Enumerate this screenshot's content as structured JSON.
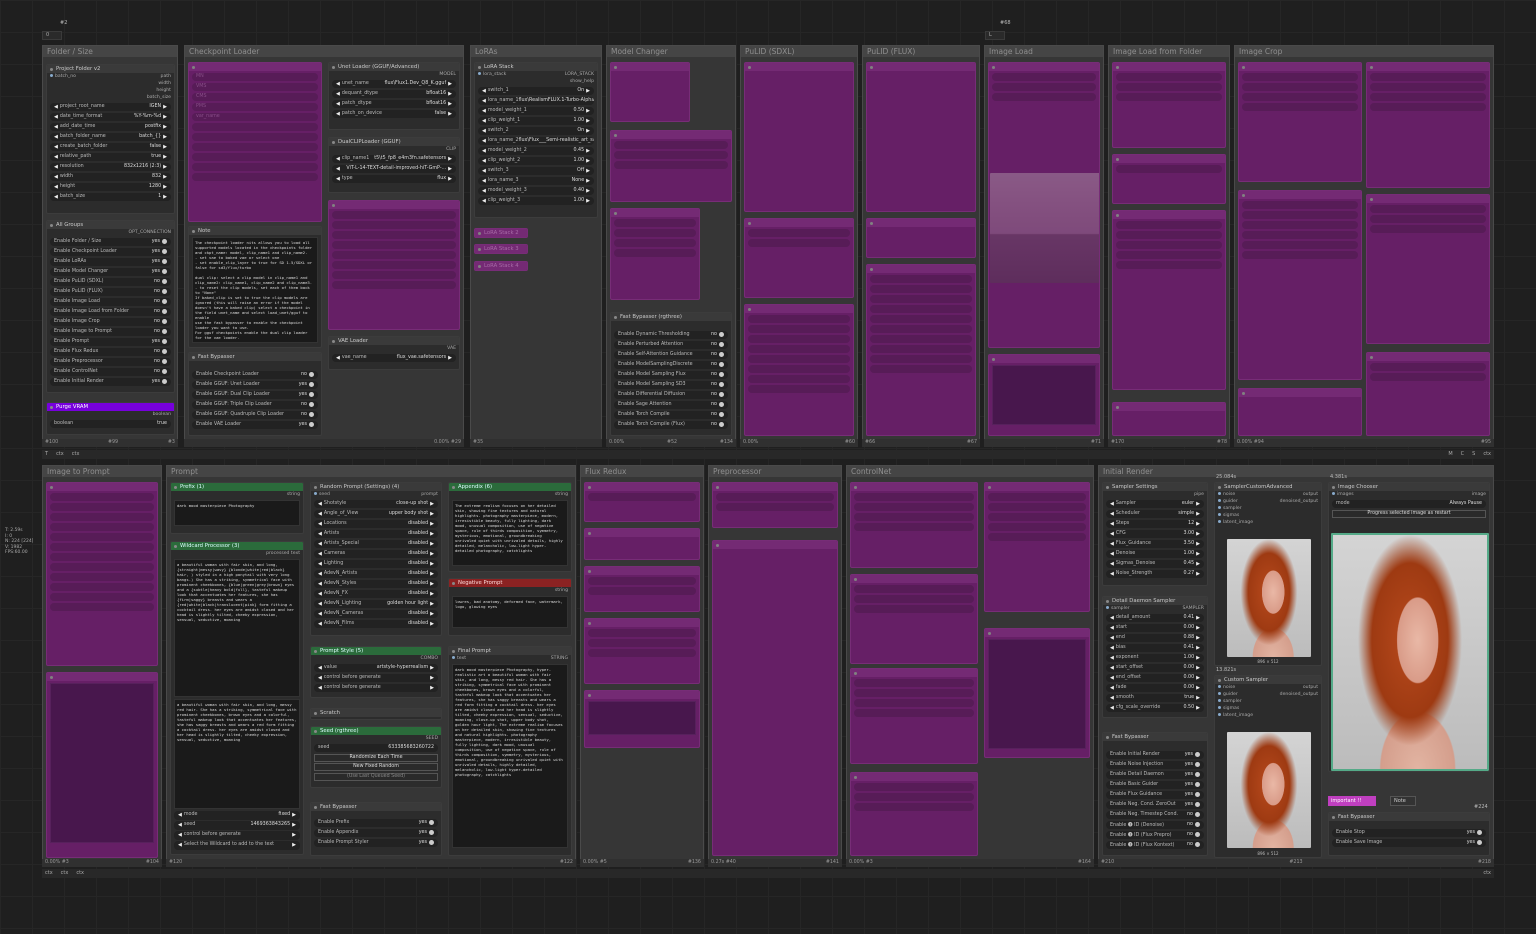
{
  "top_tags": {
    "t1": "#2",
    "t2": "#68"
  },
  "top_bars": {
    "b1": "0",
    "b2": "L"
  },
  "side_info": {
    "l1": "T: 2.59s",
    "l2": "I: 0",
    "l3": "N: 224 [224]",
    "l4": "V: 1982",
    "l5": "FPS:60.00"
  },
  "groups": {
    "folder_size": "Folder / Size",
    "checkpoint_loader": "Checkpoint Loader",
    "loras": "LoRAs",
    "model_changer": "Model Changer",
    "pulid_sdxl": "PuLID (SDXL)",
    "pulid_flux": "PuLID (FLUX)",
    "image_load": "Image Load",
    "image_load_folder": "Image Load from Folder",
    "image_crop": "Image Crop",
    "image_to_prompt": "Image to Prompt",
    "prompt": "Prompt",
    "flux_redux": "Flux Redux",
    "preprocessor": "Preprocessor",
    "controlnet": "ControlNet",
    "initial_render": "Initial Render"
  },
  "project_folder": {
    "title": "Project Folder v2",
    "id": "#5",
    "out1": "batch_no",
    "out_path": "path",
    "out_width": "width",
    "out_height": "height",
    "out_batch": "batch_size",
    "rows": [
      {
        "k": "project_root_name",
        "v": "IGEN"
      },
      {
        "k": "date_time_format",
        "v": "%Y-%m-%d"
      },
      {
        "k": "add_date_time",
        "v": "postfix"
      },
      {
        "k": "batch_folder_name",
        "v": "batch_{}"
      },
      {
        "k": "create_batch_folder",
        "v": "false"
      },
      {
        "k": "relative_path",
        "v": "true"
      },
      {
        "k": "resolution",
        "v": "832x1216 (2:3)"
      },
      {
        "k": "width",
        "v": "832"
      },
      {
        "k": "height",
        "v": "1280"
      },
      {
        "k": "batch_size",
        "v": "1"
      }
    ],
    "footer_id": "#1"
  },
  "all_groups": {
    "title": "All Groups",
    "out": "OPT_CONNECTION",
    "rows": [
      {
        "k": "Enable Folder / Size",
        "v": "yes"
      },
      {
        "k": "Enable Checkpoint Loader",
        "v": "yes"
      },
      {
        "k": "Enable LoRAs",
        "v": "yes"
      },
      {
        "k": "Enable Model Changer",
        "v": "yes"
      },
      {
        "k": "Enable PuLID (SDXL)",
        "v": "no"
      },
      {
        "k": "Enable PuLID (FLUX)",
        "v": "no"
      },
      {
        "k": "Enable Image Load",
        "v": "no"
      },
      {
        "k": "Enable Image Load from Folder",
        "v": "no"
      },
      {
        "k": "Enable Image Crop",
        "v": "no"
      },
      {
        "k": "Enable Image to Prompt",
        "v": "no"
      },
      {
        "k": "Enable Prompt",
        "v": "yes"
      },
      {
        "k": "Enable Flux Redux",
        "v": "no"
      },
      {
        "k": "Enable Preprocessor",
        "v": "no"
      },
      {
        "k": "Enable ControlNet",
        "v": "no"
      },
      {
        "k": "Enable Initial Render",
        "v": "yes"
      }
    ]
  },
  "purge_vram": {
    "title": "Purge VRAM",
    "out": "boolean",
    "row_k": "boolean",
    "row_v": "true",
    "id": "#3"
  },
  "folder_foot": {
    "a": "#100",
    "b": "#99"
  },
  "checkpoint_muted": {
    "id": "#17",
    "labels": [
      "MN",
      "VMS",
      "CMS",
      "PMS",
      "var_name"
    ],
    "tags": [
      "#16",
      "#18",
      "#19",
      "#20"
    ]
  },
  "note": {
    "title": "Note",
    "text": "The checkpoint loader nits allows you to load all supported models located in the checkpoints folder and ckpt_name: model, clip_name1 and clip_name2.\n- set vae to baked vae or select one\n- set enable_clip_layer to true for SD 1.5/SDXL or false for sd3/flux/turbo\n\ndual clip: select a clip model in clip_name1 and clip_name2: clip_name1, clip_name2 and clip_name3.\n- to reset the clip models, set each of them back to \"None\"\nIf baked_clip is set to true the clip models are ignored (this will raise an error if the model doesn't have a baked clip) select a checkpoint in the field unet_name and select load_unet/gguf to enable\nuse the fast bypasser to enable the checkpoint loader you want to use.\nFor gguf checkpoints enable the dual clip loader for the vae loader.",
    "id": "#27"
  },
  "fast_bypasser_ckpt": {
    "title": "Fast Bypasser",
    "rows": [
      {
        "k": "Enable Checkpoint Loader",
        "v": "no"
      },
      {
        "k": "Enable GGUF: Unet Loader",
        "v": "yes"
      },
      {
        "k": "Enable GGUF: Dual Clip Loader",
        "v": "yes"
      },
      {
        "k": "Enable GGUF: Triple Clip Loader",
        "v": "no"
      },
      {
        "k": "Enable GGUF: Quadruple Clip Loader",
        "v": "no"
      },
      {
        "k": "Enable VAE Loader",
        "v": "yes"
      }
    ]
  },
  "unet_loader": {
    "title": "Unet Loader (GGUF/Advanced)",
    "id": "#26",
    "out": "MODEL",
    "rows": [
      {
        "k": "unet_name",
        "v": "flux\\Flux1.Dev_Q8_K.gguf"
      },
      {
        "k": "dequant_dtype",
        "v": "bfloat16"
      },
      {
        "k": "patch_dtype",
        "v": "bfloat16"
      },
      {
        "k": "patch_on_device",
        "v": "false"
      }
    ],
    "foot_id": "#15"
  },
  "dual_clip": {
    "title": "DualCLIPLoader (GGUF)",
    "out": "CLIP",
    "rows": [
      {
        "k": "clip_name1",
        "v": "t5\\t5_fp8_e4m3fn.safetensors"
      },
      {
        "k": "",
        "v": "ViT-L-14-TEXT-detail-improved-hiT-GmP-..."
      },
      {
        "k": "type",
        "v": "flux"
      }
    ]
  },
  "vae_loader": {
    "title": "VAE Loader",
    "out": "VAE",
    "rows": [
      {
        "k": "vae_name",
        "v": "flux_vae.safetensors"
      }
    ],
    "id": "#28"
  },
  "checkpoint_foot": {
    "a": "0.00%",
    "b": "#29"
  },
  "lora_stack": {
    "title": "LoRA Stack",
    "id": "#37",
    "in1": "lora_stack",
    "out1": "LORA_STACK",
    "out2": "show_help",
    "rows": [
      {
        "k": "switch_1",
        "v": "On"
      },
      {
        "k": "lora_name_1",
        "v": "flux\\RealismFLUX.1-Turbo-Alpha.saf..."
      },
      {
        "k": "model_weight_1",
        "v": "0.50"
      },
      {
        "k": "clip_weight_1",
        "v": "1.00"
      },
      {
        "k": "switch_2",
        "v": "On"
      },
      {
        "k": "lora_name_2",
        "v": "flux\\Flux___Semi-realistic_art_style-00..."
      },
      {
        "k": "model_weight_2",
        "v": "0.45"
      },
      {
        "k": "clip_weight_2",
        "v": "1.00"
      },
      {
        "k": "switch_3",
        "v": "Off"
      },
      {
        "k": "lora_name_3",
        "v": "None"
      },
      {
        "k": "model_weight_3",
        "v": "0.40"
      },
      {
        "k": "clip_weight_3",
        "v": "1.00"
      }
    ],
    "stack2": "LoRA Stack 2",
    "stack2_id": "#31",
    "stack3": "LoRA Stack 3",
    "stack3_id": "#32",
    "stack4": "LoRA Stack 4",
    "foot": "#35"
  },
  "model_changer_bypass": {
    "title": "Fast Bypasser (rgthree)",
    "id": "#51",
    "rows": [
      {
        "k": "Enable Dynamic Thresholding",
        "v": "no"
      },
      {
        "k": "Enable Perturbed Attention",
        "v": "no"
      },
      {
        "k": "Enable Self-Attention Guidance",
        "v": "no"
      },
      {
        "k": "Enable ModelSamplingDiscrete",
        "v": "no"
      },
      {
        "k": "Enable Model Sampling Flux",
        "v": "no"
      },
      {
        "k": "Enable Model Sampling SD3",
        "v": "no"
      },
      {
        "k": "Enable Differential Diffusion",
        "v": "no"
      },
      {
        "k": "Enable Sage Attention",
        "v": "no"
      },
      {
        "k": "Enable Torch Compile",
        "v": "no"
      },
      {
        "k": "Enable Torch Compile (Flux)",
        "v": "no"
      }
    ]
  },
  "top_foot_ids": {
    "mc_a": "0.00%",
    "mc_b": "#36",
    "mc_c": "#52",
    "mc_d": "#134",
    "mc_e": "#139",
    "ps_a": "0.00%",
    "ps_b": "#59",
    "ps_c": "#60",
    "pf_a": "#66",
    "pf_b": "#67",
    "il_a": "#71",
    "if_a": "#170",
    "if_b": "#78",
    "ic_a": "0.00%",
    "ic_b": "#94",
    "ic_c": "#95"
  },
  "bottom_labels": {
    "l1": "T",
    "l2": "M",
    "l3": "C",
    "l4": "S",
    "ctx": "ctx"
  },
  "prefix": {
    "title": "Prefix (1)",
    "id": "#112",
    "out": "string",
    "text": "dark mood masterpiece Photography",
    "foot_id": "#128"
  },
  "wildcard": {
    "title": "Wildcard Processor (3)",
    "out": "processed text",
    "text1": "a beautiful woman with fair skin, and long, {straight|messy|wavy} {blonde|white|red|black} hair, ) styled in a high ponytail with very long bangs.) She has a striking, symmetrical face with prominent cheekbones, {blue|green|grey|brown} eyes and a {subtle|heavy bold|full}, tasteful makeup look that accentuates her features, she has {firm|saggy} breasts and wears a {red|white|black|translucent|pink} form fitting a cocktail dress. her eyes are amidst closed and her head is slightly tilted, cheeky expression, sensual, seductive, moaning",
    "text2": "a beautiful woman with fair skin, and long, messy red hair. She has a striking, symmetrical face with prominent cheekbones, brown eyes and a colorful, tasteful makeup look that accentuates her features, she has saggy breasts and wears a red form fitting a cocktail dress. her eyes are amidst closed and her head is slightly tilted, cheeky expression, sensual, seductive, moaning",
    "rows": [
      {
        "k": "mode",
        "v": "fixed"
      },
      {
        "k": "seed",
        "v": "1469363843265"
      },
      {
        "k": "control before generate",
        "v": ""
      },
      {
        "k": "Select the Wildcard to add to the text",
        "v": ""
      }
    ],
    "foot_id": "#120"
  },
  "random_prompt": {
    "title": "Random Prompt (Settings) (4)",
    "id": "#121",
    "in": "seed",
    "out": "prompt",
    "rows": [
      {
        "k": "Shotstyle",
        "v": "close-up shot"
      },
      {
        "k": "Angle_of_View",
        "v": "upper body shot"
      },
      {
        "k": "Locations",
        "v": "disabled"
      },
      {
        "k": "Artists",
        "v": "disabled"
      },
      {
        "k": "Artists_Special",
        "v": "disabled"
      },
      {
        "k": "Cameras",
        "v": "disabled"
      },
      {
        "k": "Lighting",
        "v": "disabled"
      },
      {
        "k": "AdevN_Artists",
        "v": "disabled"
      },
      {
        "k": "AdevN_Styles",
        "v": "disabled"
      },
      {
        "k": "AdevN_FX",
        "v": "disabled"
      },
      {
        "k": "AdevN_Lighting",
        "v": "golden hour light"
      },
      {
        "k": "AdevN_Cameras",
        "v": "disabled"
      },
      {
        "k": "AdevN_Films",
        "v": "disabled"
      }
    ]
  },
  "prompt_style": {
    "title": "Prompt Style (5)",
    "out": "COMBO",
    "rows": [
      {
        "k": "value",
        "v": "artstyle-hyperrealism"
      },
      {
        "k": "control before generate",
        "v": ""
      },
      {
        "k": "control before generate",
        "v": ""
      }
    ],
    "foot_id": "#118"
  },
  "scratch": {
    "title": "Scratch"
  },
  "seed": {
    "title": "Seed (rgthree)",
    "out": "SEED",
    "rows": [
      {
        "k": "seed",
        "v": "633385683260722"
      }
    ],
    "btn1": "Randomize Each Time",
    "btn2": "New Fixed Random",
    "btn3": "(Use Last Queued Seed)",
    "foot_id": "#119"
  },
  "prompt_bypasser": {
    "title": "Fast Bypasser",
    "rows": [
      {
        "k": "Enable Prefix",
        "v": "yes"
      },
      {
        "k": "Enable Appendix",
        "v": "yes"
      },
      {
        "k": "Enable Prompt Styler",
        "v": "yes"
      }
    ]
  },
  "appendix": {
    "title": "Appendix (6)",
    "id": "#116",
    "out": "string",
    "text": "The extreme realism focuses on her detailed skin, showing fine textures and natural highlights. photography masterpiece, modern, irresistible beauty, fully lighting, dark mood, unusual composition, use of negative space, rule of thirds composition, symmetry, mysterious, emotional, groundbreaking unrivaled quiet with unrivaled details, highly detailed, melancholic, low-light hyper-detailed photography, catchlights",
    "foot_id": "#117"
  },
  "negative": {
    "title": "Negative Prompt",
    "out": "string",
    "text": "lowres, bad anatomy, deformed face, watermark, logo, glowing eyes",
    "foot_a": "0.22%",
    "foot_id": "#127"
  },
  "final_prompt": {
    "title": "Final Prompt",
    "in": "text",
    "out": "STRING",
    "text": "dark mood masterpiece Photography, hyper-realistic art a beautiful woman with fair skin, and long, messy red hair. She has a striking, symmetrical face with prominent cheekbones, brown eyes and a colorful, tasteful makeup look that accentuates her features, she has saggy breasts and wears a red form fitting a cocktail dress. her eyes are amidst closed and her head is slightly tilted, cheeky expression, sensual, seductive, moaning, close-up shot, upper body shot, golden hour light, The extreme realism focuses on her detailed skin, showing fine textures and natural highlights. photography masterpiece, modern, irresistible beauty, fully lighting, dark mood, unusual composition, use of negative space, rule of thirds composition, symmetry, mysterious, emotional, groundbreaking unrivaled quiet with unrivaled details, highly detailed, melancholic, low-light hyper-detailed photography, catchlights",
    "foot_id": "#122"
  },
  "bottom_foot_ids": {
    "itp_a": "0.00%",
    "itp_b": "#3",
    "itp_c": "#104",
    "fr_a": "0.00%",
    "fr_b": "#5",
    "fr_c": "#136",
    "pp_a": "0.27s",
    "pp_b": "#40",
    "pp_c": "#141",
    "cn_a": "0.00%",
    "cn_b": "#3",
    "cn_c": "#164",
    "ir_a": "#210",
    "ir_b": "#218",
    "ir_c": "#213"
  },
  "sampler_settings": {
    "title": "Sampler Settings",
    "id": "#211",
    "out": "pipe",
    "rows": [
      {
        "k": "Sampler",
        "v": "euler"
      },
      {
        "k": "Scheduler",
        "v": "simple"
      },
      {
        "k": "Steps",
        "v": "12"
      },
      {
        "k": "CFG",
        "v": "3.00"
      },
      {
        "k": "Flux_Guidance",
        "v": "3.50"
      },
      {
        "k": "Denoise",
        "v": "1.00"
      },
      {
        "k": "Sigmas_Denoise",
        "v": "0.45"
      },
      {
        "k": "Noise_Strength",
        "v": "0.27"
      }
    ],
    "foot_id": "#212"
  },
  "detail_daemon": {
    "title": "Detail Daemon Sampler",
    "in": "sampler",
    "out": "SAMPLER",
    "rows": [
      {
        "k": "detail_amount",
        "v": "0.41"
      },
      {
        "k": "start",
        "v": "0.00"
      },
      {
        "k": "end",
        "v": "0.88"
      },
      {
        "k": "bias",
        "v": "0.41"
      },
      {
        "k": "exponent",
        "v": "1.00"
      },
      {
        "k": "start_offset",
        "v": "0.00"
      },
      {
        "k": "end_offset",
        "v": "0.00"
      },
      {
        "k": "fade",
        "v": "0.00"
      },
      {
        "k": "smooth",
        "v": "true"
      },
      {
        "k": "cfg_scale_override",
        "v": "0.50"
      }
    ],
    "foot_id": "#222"
  },
  "render_bypasser": {
    "title": "Fast Bypasser",
    "rows": [
      {
        "k": "Enable Initial Render",
        "v": "yes"
      },
      {
        "k": "Enable Noise Injection",
        "v": "yes"
      },
      {
        "k": "Enable Detail Daemon",
        "v": "yes"
      },
      {
        "k": "Enable Basic Guider",
        "v": "yes"
      },
      {
        "k": "Enable Flux Guidance",
        "v": "yes"
      },
      {
        "k": "Enable Neg. Cond. ZeroOut",
        "v": "yes"
      },
      {
        "k": "Enable Neg. Timestep Cond.",
        "v": "no"
      },
      {
        "k": "Enable 🅘 ID (Denoise)",
        "v": "no"
      },
      {
        "k": "Enable 🅘 ID (Flux Prepro)",
        "v": "no"
      },
      {
        "k": "Enable 🅘 ID (Flux Kontext)",
        "v": "no"
      }
    ]
  },
  "sampler_custom": {
    "time": "25.084s",
    "id": "#215",
    "title": "SamplerCustomAdvanced",
    "ins": [
      "noise",
      "guider",
      "sampler",
      "sigmas",
      "latent_image"
    ],
    "outs": [
      "output",
      "denoised_output"
    ],
    "img_caption": "896 × 512"
  },
  "custom_sampler": {
    "time": "13.821s",
    "id": "#214",
    "title": "Custom Sampler",
    "ins": [
      "noise",
      "guider",
      "sampler",
      "sigmas",
      "latent_image"
    ],
    "outs": [
      "output",
      "denoised_output"
    ],
    "img_caption": "896 × 512"
  },
  "image_chooser": {
    "time": "4.381s",
    "id": "#223",
    "title": "Image Chooser",
    "in": "images",
    "out": "image",
    "mode_k": "mode",
    "mode_v": "Always Pause",
    "progress_btn": "Progress selected image as restart",
    "btn_a": "important !!",
    "btn_b": "Note",
    "foot_id": "#224"
  },
  "chooser_bypasser": {
    "title": "Fast Bypasser",
    "rows": [
      {
        "k": "Enable Stop",
        "v": "yes"
      },
      {
        "k": "Enable Save Image",
        "v": "yes"
      }
    ]
  }
}
